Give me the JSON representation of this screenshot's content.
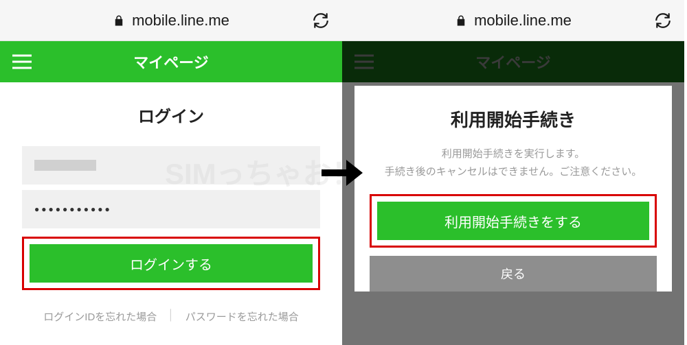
{
  "browser": {
    "url": "mobile.line.me"
  },
  "header": {
    "title": "マイページ"
  },
  "left": {
    "login_title": "ログイン",
    "password_dots": "●●●●●●●●●●●",
    "login_button": "ログインする",
    "forgot_id": "ログインIDを忘れた場合",
    "forgot_pw": "パスワードを忘れた場合"
  },
  "right": {
    "modal_title": "利用開始手続き",
    "modal_desc_1": "利用開始手続きを実行します。",
    "modal_desc_2": "手続き後のキャンセルはできません。ご注意ください。",
    "proceed_button": "利用開始手続きをする",
    "back_button": "戻る"
  },
  "watermark": "SIMっちゃお！"
}
